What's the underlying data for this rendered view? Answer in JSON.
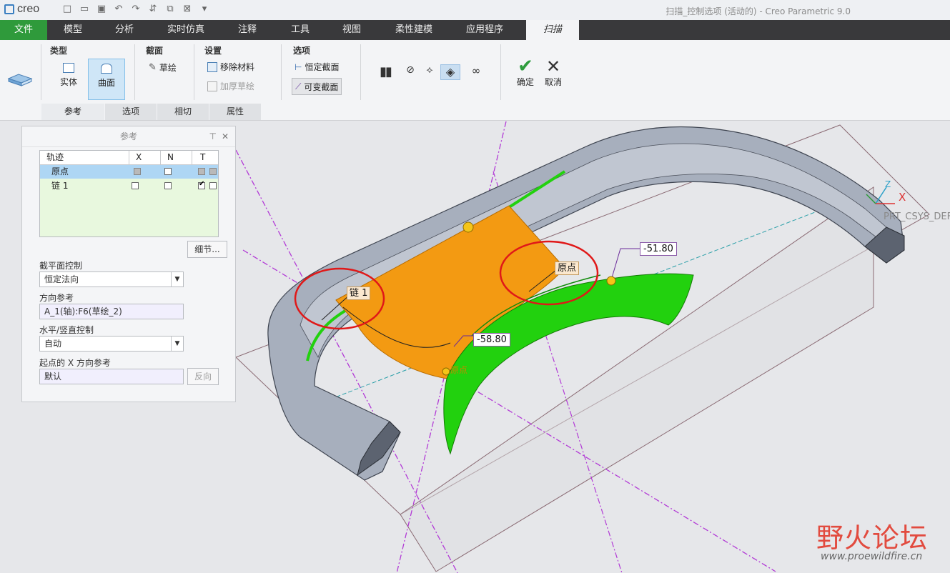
{
  "app": {
    "logo_text": "creo",
    "window_title": "扫描_控制选项 (活动的) - Creo Parametric 9.0"
  },
  "quick_access": [
    "new-icon",
    "open-icon",
    "save-icon",
    "undo-icon",
    "redo-icon",
    "regenerate-icon",
    "window-icon",
    "close-window-icon",
    "customize-icon"
  ],
  "tabs": [
    {
      "label": "文件"
    },
    {
      "label": "模型"
    },
    {
      "label": "分析"
    },
    {
      "label": "实时仿真"
    },
    {
      "label": "注释"
    },
    {
      "label": "工具"
    },
    {
      "label": "视图"
    },
    {
      "label": "柔性建模"
    },
    {
      "label": "应用程序"
    },
    {
      "label": "扫描"
    }
  ],
  "ribbon": {
    "type_group": "类型",
    "type_solid": "实体",
    "type_surface": "曲面",
    "section_group": "截面",
    "sketch": "草绘",
    "settings_group": "设置",
    "remove_material": "移除材料",
    "thicken_sketch": "加厚草绘",
    "options_group": "选项",
    "constant_section": "恒定截面",
    "variable_section": "可变截面",
    "ok": "确定",
    "cancel": "取消",
    "subtabs": [
      {
        "label": "参考"
      },
      {
        "label": "选项"
      },
      {
        "label": "相切"
      },
      {
        "label": "属性"
      }
    ]
  },
  "panel": {
    "title": "参考",
    "table_headers": [
      "轨迹",
      "X",
      "N",
      "T"
    ],
    "rows": [
      {
        "name": "原点"
      },
      {
        "name": "链 1"
      }
    ],
    "details_button": "细节...",
    "section_plane_label": "截平面控制",
    "section_plane_value": "恒定法向",
    "direction_ref_label": "方向参考",
    "direction_ref_value": "A_1(轴):F6(草绘_2)",
    "hv_control_label": "水平/竖直控制",
    "hv_control_value": "自动",
    "start_x_label": "起点的 X 方向参考",
    "start_x_value": "默认",
    "flip_button": "反向"
  },
  "viewport": {
    "chain_tag": "链 1",
    "origin_tag": "原点",
    "dim1": "-51.80",
    "dim2": "-58.80",
    "start_label": "原点",
    "csys_label": "PRT_CSYS_DEF",
    "axis_x": "X",
    "axis_z": "Z"
  },
  "watermark": {
    "title": "野火论坛",
    "url": "www.proewildfire.cn"
  },
  "colors": {
    "accent_green": "#2f9a3b",
    "tab_bar": "#39393b",
    "surface_orange": "#f39a12",
    "surface_green": "#22d10e",
    "highlight_red": "#e01818"
  }
}
